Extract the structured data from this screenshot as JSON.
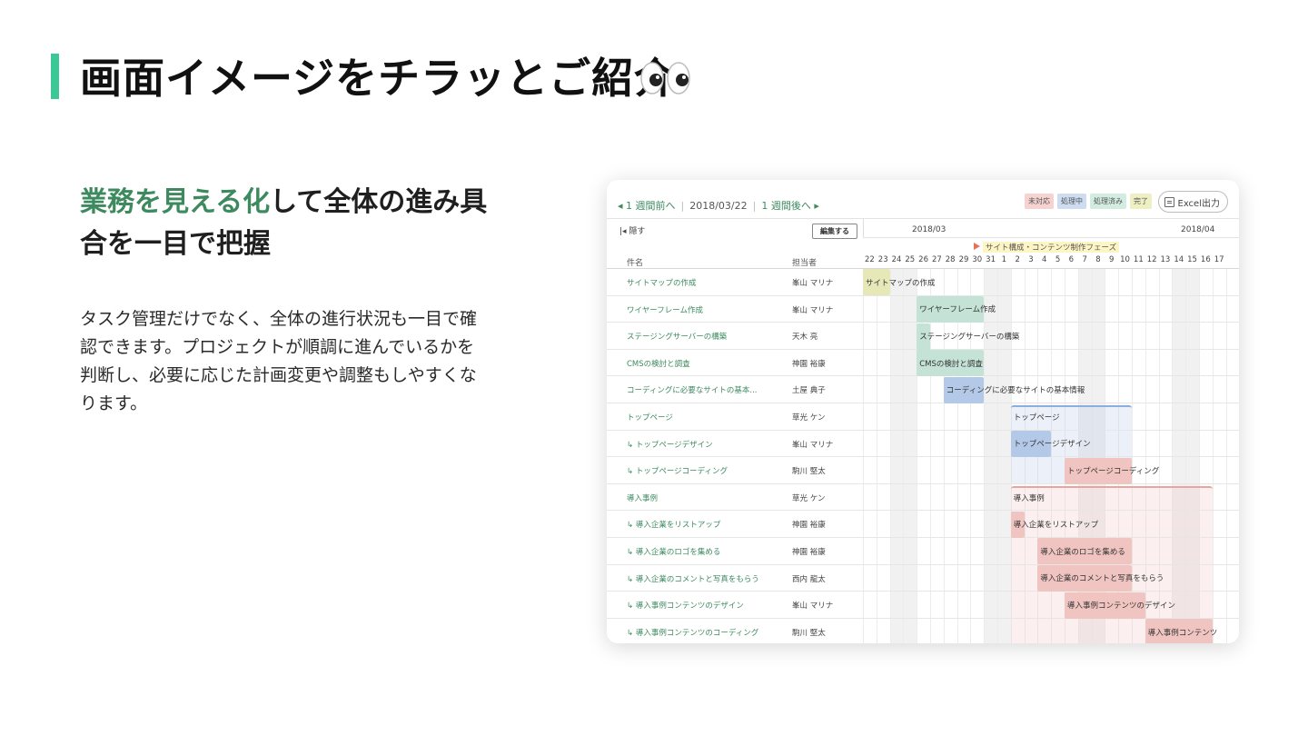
{
  "heading": {
    "title": "画面イメージをチラッとご紹介",
    "eyes_icon": "eyes-emoji"
  },
  "left": {
    "subtitle_highlight": "業務を見える化",
    "subtitle_rest": "して全体の進み具合を一目で把握",
    "body": "タスク管理だけでなく、全体の進行状況も一目で確認できます。プロジェクトが順調に進んでいるかを判断し、必要に応じた計画変更や調整もしやすくなります。"
  },
  "app": {
    "nav": {
      "prev_week": "◂ 1 週間前へ",
      "date": "2018/03/22",
      "next_week": "1 週間後へ ▸"
    },
    "legend": [
      {
        "label": "未対応",
        "color": "#f6d3d0"
      },
      {
        "label": "処理中",
        "color": "#cddcf0"
      },
      {
        "label": "処理済み",
        "color": "#d3ece2"
      },
      {
        "label": "完了",
        "color": "#eef0c4"
      }
    ],
    "excel_button": "Excel出力",
    "hide_button": "隠す",
    "edit_button": "編集する",
    "months": [
      "2018/03",
      "2018/04"
    ],
    "phase_label": "サイト構成・コンテンツ制作フェーズ",
    "columns": {
      "name": "件名",
      "owner": "担当者"
    },
    "days": [
      "22",
      "23",
      "24",
      "25",
      "26",
      "27",
      "28",
      "29",
      "30",
      "31",
      "1",
      "2",
      "3",
      "4",
      "5",
      "6",
      "7",
      "8",
      "9",
      "10",
      "11",
      "12",
      "13",
      "14",
      "15",
      "16",
      "17"
    ],
    "tasks": [
      {
        "name": "サイトマップの作成",
        "owner": "峯山 マリナ",
        "bar_label": "サイトマップの作成",
        "color": "#e6e8b8"
      },
      {
        "name": "ワイヤーフレーム作成",
        "owner": "峯山 マリナ",
        "bar_label": "ワイヤーフレーム作成",
        "color": "#c4e2d6"
      },
      {
        "name": "ステージングサーバーの構築",
        "owner": "天木 亮",
        "bar_label": "ステージングサーバーの構築",
        "color": "#c4e2d6"
      },
      {
        "name": "CMSの検討と調査",
        "owner": "神園 裕康",
        "bar_label": "CMSの検討と調査",
        "color": "#c4e2d6"
      },
      {
        "name": "コーディングに必要なサイトの基本...",
        "owner": "土屋 典子",
        "bar_label": "コーディングに必要なサイトの基本情報",
        "color": "#b4c9e8"
      },
      {
        "name": "トップページ",
        "owner": "草光 ケン",
        "bar_label": "トップページ",
        "color": "#b4c9e8"
      },
      {
        "name": "↳ トップページデザイン",
        "owner": "峯山 マリナ",
        "bar_label": "トップページデザイン",
        "color": "#b4c9e8"
      },
      {
        "name": "↳ トップページコーディング",
        "owner": "駒川 堅太",
        "bar_label": "トップページコーディング",
        "color": "#f0c4c0"
      },
      {
        "name": "導入事例",
        "owner": "草光 ケン",
        "bar_label": "導入事例",
        "color": "#f0c4c0"
      },
      {
        "name": "↳ 導入企業をリストアップ",
        "owner": "神園 裕康",
        "bar_label": "導入企業をリストアップ",
        "color": "#f0c4c0"
      },
      {
        "name": "↳ 導入企業のロゴを集める",
        "owner": "神園 裕康",
        "bar_label": "導入企業のロゴを集める",
        "color": "#f0c4c0"
      },
      {
        "name": "↳ 導入企業のコメントと写真をもらう",
        "owner": "西内 龍太",
        "bar_label": "導入企業のコメントと写真をもらう",
        "color": "#f0c4c0"
      },
      {
        "name": "↳ 導入事例コンテンツのデザイン",
        "owner": "峯山 マリナ",
        "bar_label": "導入事例コンテンツのデザイン",
        "color": "#f0c4c0"
      },
      {
        "name": "↳ 導入事例コンテンツのコーディング",
        "owner": "駒川 堅太",
        "bar_label": "導入事例コンテンツ",
        "color": "#f0c4c0"
      }
    ]
  }
}
